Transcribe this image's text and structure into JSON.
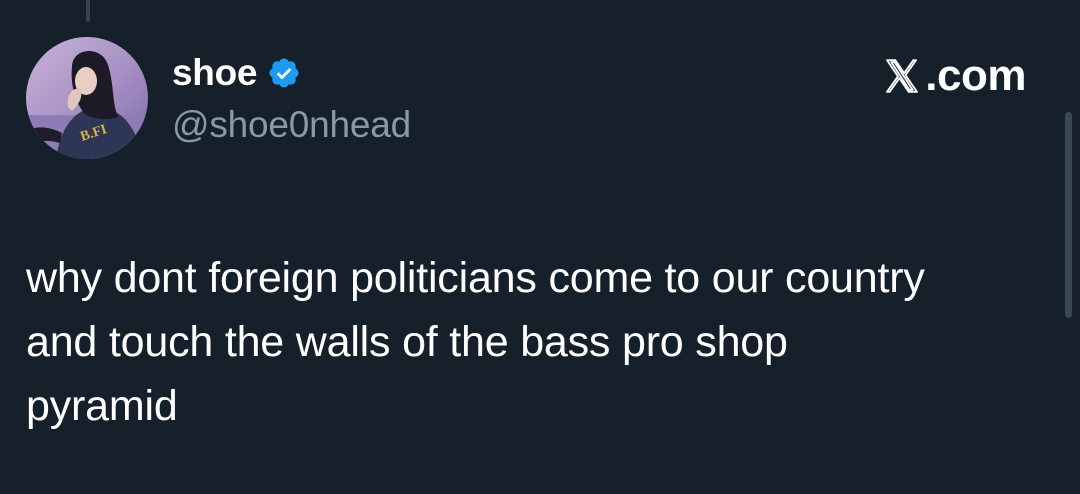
{
  "author": {
    "display_name": "shoe",
    "handle": "@shoe0nhead",
    "verified": true,
    "avatar_icon": "profile-photo"
  },
  "brand": {
    "label": ".com",
    "logo_icon": "x-logo-icon"
  },
  "tweet": {
    "text": "why dont foreign politicians come to our country\nand touch the walls of the bass pro shop\npyramid"
  },
  "colors": {
    "background": "#15202b",
    "primary_text": "#ffffff",
    "secondary_text": "#8b98a5",
    "verified_badge": "#1d9bf0"
  }
}
